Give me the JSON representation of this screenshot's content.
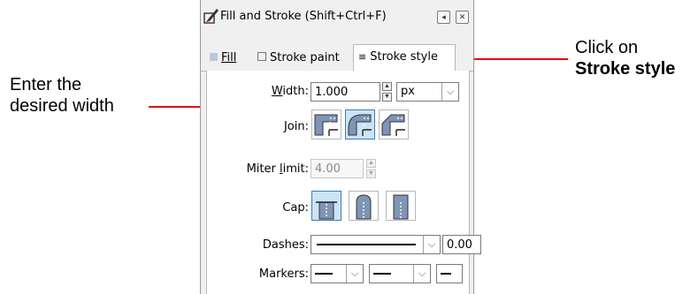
{
  "callouts": {
    "left": [
      "Enter the",
      "desired width"
    ],
    "right": [
      "Click on"
    ],
    "right_bold": "Stroke style"
  },
  "dialog": {
    "title": "Fill and Stroke (Shift+Ctrl+F)",
    "tabs": [
      {
        "label": "Fill",
        "active": false
      },
      {
        "label": "Stroke paint",
        "active": false
      },
      {
        "label": "Stroke style",
        "active": true
      }
    ],
    "width": {
      "label": "Width:",
      "value": "1.000",
      "unit": "px"
    },
    "join": {
      "label": "Join:",
      "options": [
        "miter-join",
        "round-join",
        "bevel-join"
      ],
      "selected": "round-join"
    },
    "miter_limit": {
      "label": "Miter limit:",
      "value": "4.00"
    },
    "cap": {
      "label": "Cap:",
      "options": [
        "butt-cap",
        "round-cap",
        "square-cap"
      ],
      "selected": "butt-cap"
    },
    "dashes": {
      "label": "Dashes:",
      "offset": "0.00"
    },
    "markers": {
      "label": "Markers:"
    }
  },
  "colors": {
    "arrow": "#e00000",
    "selected_button": "#cce4f7",
    "icon_fill": "#7f95b5"
  }
}
